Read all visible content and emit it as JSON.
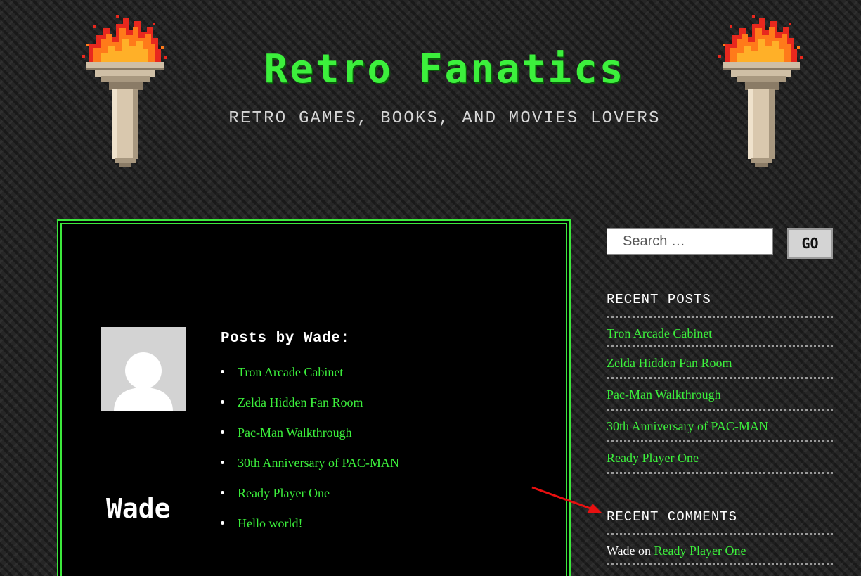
{
  "header": {
    "site_title": "Retro Fanatics",
    "tagline": "RETRO GAMES, BOOKS, AND MOVIES LOVERS"
  },
  "main": {
    "author_name": "Wade",
    "posts_heading": "Posts by Wade:",
    "posts": [
      "Tron Arcade Cabinet",
      "Zelda Hidden Fan Room",
      "Pac-Man Walkthrough",
      "30th Anniversary of PAC-MAN",
      "Ready Player One",
      "Hello world!"
    ]
  },
  "sidebar": {
    "search_placeholder": "Search …",
    "search_button": "GO",
    "recent_posts_title": "RECENT POSTS",
    "recent_posts": [
      "Tron Arcade Cabinet",
      "Zelda Hidden Fan Room",
      "Pac-Man Walkthrough",
      "30th Anniversary of PAC-MAN",
      "Ready Player One"
    ],
    "recent_comments_title": "RECENT COMMENTS",
    "recent_comments": [
      {
        "author": "Wade",
        "on": "on",
        "post": "Ready Player One"
      }
    ]
  },
  "colors": {
    "accent_green": "#3cf03c",
    "background": "#262626",
    "annotation_red": "#e81010"
  },
  "icons": {
    "torch": "torch-icon",
    "avatar": "default-avatar-icon",
    "arrow": "red-arrow-icon"
  }
}
